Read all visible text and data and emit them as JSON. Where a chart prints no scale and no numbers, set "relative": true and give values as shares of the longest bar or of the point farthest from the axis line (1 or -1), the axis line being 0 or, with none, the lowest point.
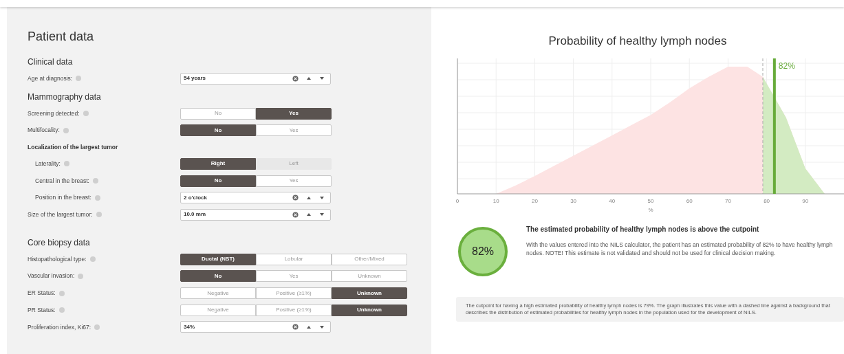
{
  "patient_panel": {
    "title": "Patient data",
    "sections": [
      {
        "title": "Clinical data",
        "rows": [
          {
            "kind": "number",
            "label": "Age at diagnosis:",
            "value": "54 years"
          }
        ]
      },
      {
        "title": "Mammography data",
        "rows": [
          {
            "kind": "toggle",
            "label": "Screening detected:",
            "options": [
              {
                "label": "No",
                "selected": false
              },
              {
                "label": "Yes",
                "selected": true
              }
            ]
          },
          {
            "kind": "toggle",
            "label": "Multifocality:",
            "options": [
              {
                "label": "No",
                "selected": true
              },
              {
                "label": "Yes",
                "selected": false
              }
            ]
          },
          {
            "kind": "group",
            "label": "Localization of the largest tumor",
            "children": [
              {
                "kind": "toggle",
                "label": "Laterality:",
                "options": [
                  {
                    "label": "Right",
                    "selected": true,
                    "disabled": false
                  },
                  {
                    "label": "Left",
                    "selected": false,
                    "disabled": true
                  }
                ]
              },
              {
                "kind": "toggle",
                "label": "Central in the breast:",
                "options": [
                  {
                    "label": "No",
                    "selected": true
                  },
                  {
                    "label": "Yes",
                    "selected": false
                  }
                ]
              },
              {
                "kind": "number",
                "label": "Position in the breast:",
                "value": "2 o'clock"
              }
            ]
          },
          {
            "kind": "number",
            "label": "Size of the largest tumor:",
            "value": "10.0 mm"
          }
        ]
      },
      {
        "title": "Core biopsy data",
        "rows": [
          {
            "kind": "toggle",
            "label": "Histopathological type:",
            "options": [
              {
                "label": "Ductal (NST)",
                "selected": true
              },
              {
                "label": "Lobular",
                "selected": false
              },
              {
                "label": "Other/Mixed",
                "selected": false
              }
            ]
          },
          {
            "kind": "toggle",
            "label": "Vascular invasion:",
            "options": [
              {
                "label": "No",
                "selected": true
              },
              {
                "label": "Yes",
                "selected": false
              },
              {
                "label": "Unknown",
                "selected": false
              }
            ]
          },
          {
            "kind": "toggle",
            "label": "ER Status:",
            "options": [
              {
                "label": "Negative",
                "selected": false
              },
              {
                "label": "Positive (≥1%)",
                "selected": false
              },
              {
                "label": "Unknown",
                "selected": true
              }
            ]
          },
          {
            "kind": "toggle",
            "label": "PR Status:",
            "options": [
              {
                "label": "Negative",
                "selected": false
              },
              {
                "label": "Positive (≥1%)",
                "selected": false
              },
              {
                "label": "Unknown",
                "selected": true
              }
            ]
          },
          {
            "kind": "number",
            "label": "Proliferation index, Ki67:",
            "value": "34%"
          }
        ]
      }
    ]
  },
  "result_panel": {
    "chart": {
      "chart_data": {
        "type": "area",
        "title": "Probability of healthy lymph nodes",
        "xlabel": "%",
        "xlim": [
          0,
          100
        ],
        "relative": true,
        "x": [
          10,
          15,
          20,
          25,
          30,
          35,
          40,
          45,
          50,
          55,
          60,
          65,
          70,
          75,
          79,
          85,
          90,
          95
        ],
        "series": [
          {
            "color": "#fde3e3",
            "values": [
              0,
              0.065,
              0.14,
              0.22,
              0.3,
              0.38,
              0.46,
              0.54,
              0.62,
              0.72,
              0.83,
              0.92,
              1,
              1,
              0.92,
              0.6,
              0.2,
              0
            ]
          }
        ],
        "xticks": [
          0,
          10,
          20,
          30,
          40,
          50,
          60,
          70,
          80,
          90
        ],
        "grid": true,
        "ref_lines": [
          {
            "axis": "x",
            "value": 79,
            "color": "#aaaaaa"
          },
          {
            "axis": "x",
            "value": 82,
            "color": "#67ab3a",
            "label": "82%"
          }
        ]
      }
    },
    "estimate": {
      "value": "82%",
      "heading": "The estimated probability of healthy lymph nodes is above the cutpoint",
      "text": "With the values entered into the NILS calculator, the patient has an estimated probability of 82% to have healthy lymph nodes. NOTE! This estimate is not validated and should not be used for clinical decision making."
    },
    "note": "The cutpoint for having a high estimated probability of healthy lymph nodes is 79%. The graph illustrates this value with a dashed line against a background that describes the distribution of estimated probabilities for healthy lymph nodes in the population used for the development of NILS."
  }
}
